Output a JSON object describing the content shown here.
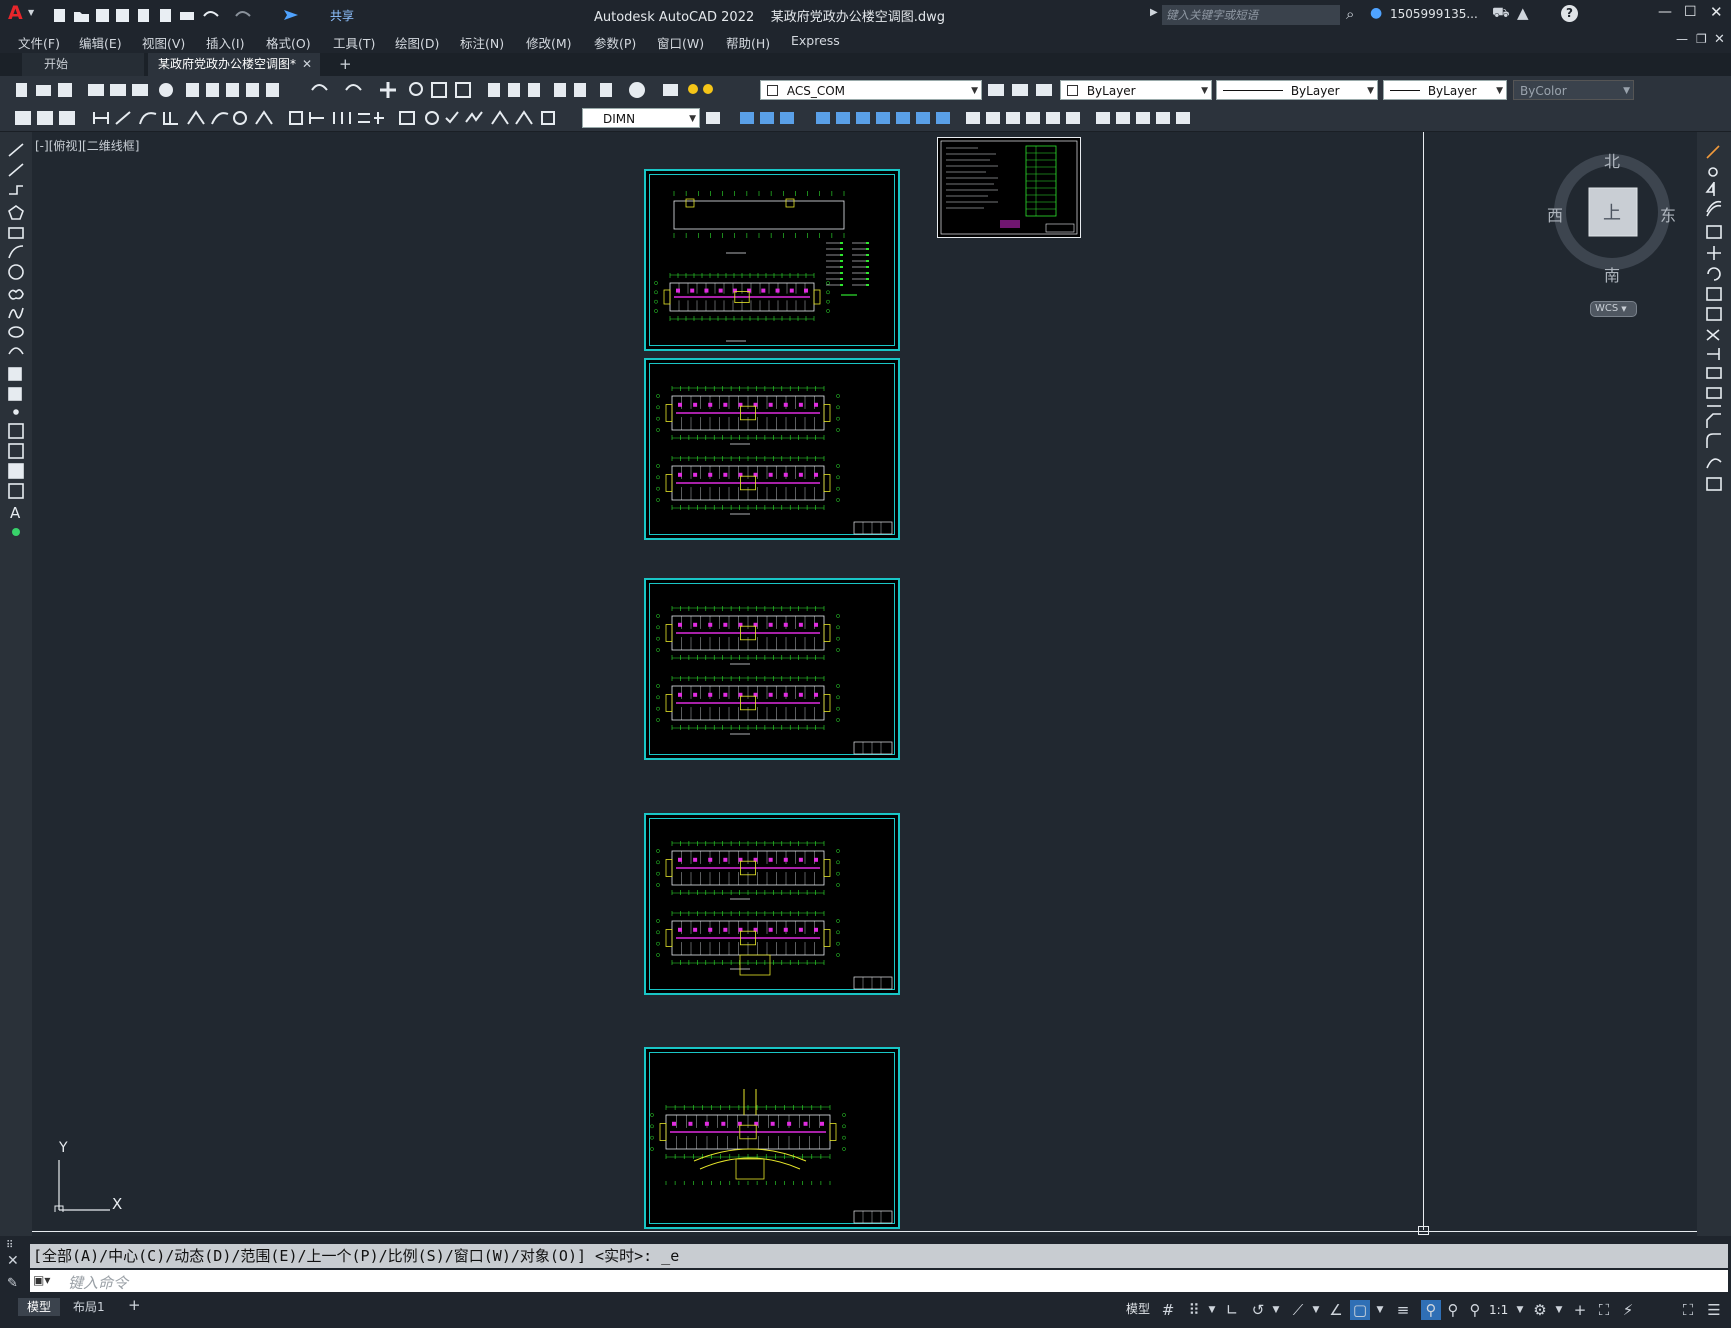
{
  "window": {
    "app_logo": "A",
    "title": "Autodesk AutoCAD 2022    某政府党政办公楼空调图.dwg",
    "share_label": "共享",
    "search_placeholder": "键入关键字或短语",
    "user_name": "1505999135...",
    "help_icon": "?"
  },
  "menu": {
    "items": [
      "文件(F)",
      "编辑(E)",
      "视图(V)",
      "插入(I)",
      "格式(O)",
      "工具(T)",
      "绘图(D)",
      "标注(N)",
      "修改(M)",
      "参数(P)",
      "窗口(W)",
      "帮助(H)",
      "Express"
    ]
  },
  "tabs": {
    "start": "开始",
    "active": "某政府党政办公楼空调图*",
    "close": "✕",
    "add": "+"
  },
  "layers": {
    "current_layer": "ACS_COM",
    "color": "ByLayer",
    "linetype": "ByLayer",
    "lineweight": "ByLayer",
    "plotstyle": "ByColor",
    "dim_style": "DIMN"
  },
  "viewport": {
    "label": "[-][俯视][二维线框]",
    "viewcube": {
      "north": "北",
      "south": "南",
      "east": "东",
      "west": "西",
      "face": "上",
      "wcs": "WCS"
    },
    "ucs": {
      "x": "X",
      "y": "Y"
    }
  },
  "command": {
    "history": "[全部(A)/中心(C)/动态(D)/范围(E)/上一个(P)/比例(S)/窗口(W)/对象(O)] <实时>: _e",
    "placeholder": "键入命令"
  },
  "status": {
    "model_tab": "模型",
    "layout_tab": "布局1",
    "add_tab": "+",
    "model_button": "模型",
    "scale": "1:1"
  },
  "colors": {
    "background": "#212830",
    "sheet_frame": "#19c6c6",
    "drawing_green": "#2fe62f",
    "drawing_magenta": "#e02ce0",
    "drawing_yellow": "#e6e62a"
  }
}
